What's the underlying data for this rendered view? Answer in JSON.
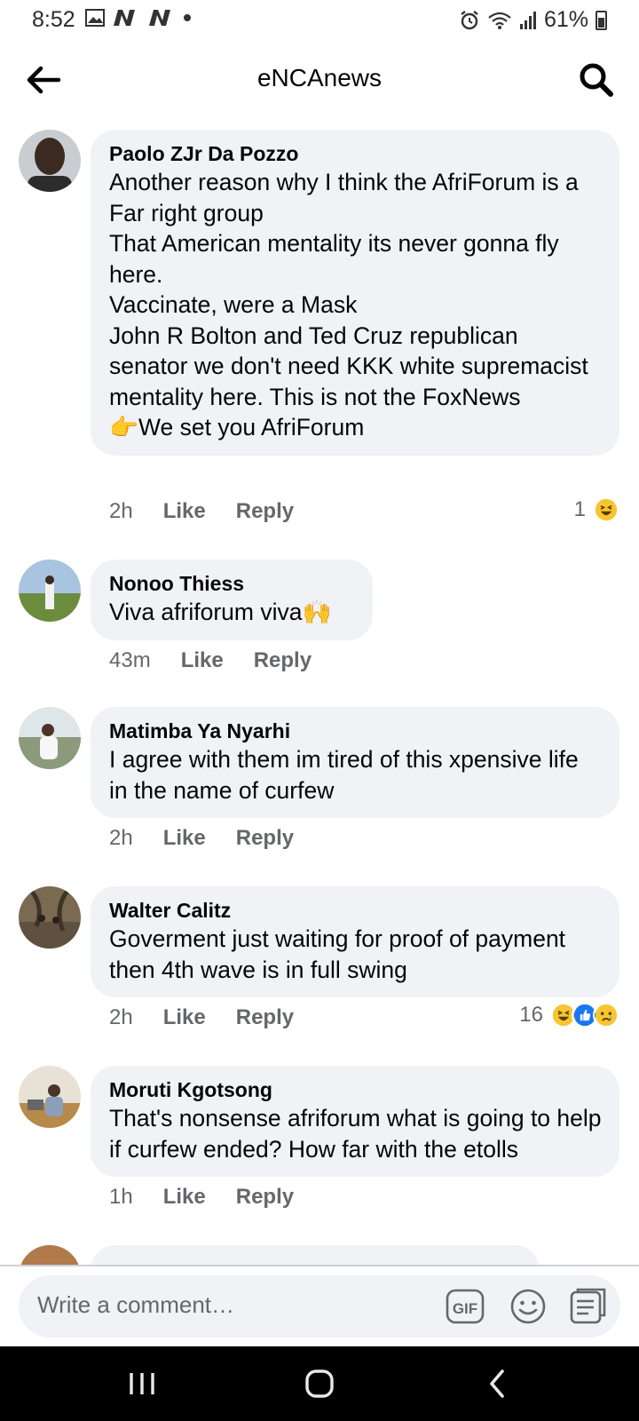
{
  "status_bar": {
    "time": "8:52",
    "battery": "61%"
  },
  "header": {
    "title": "eNCAnews"
  },
  "comments": [
    {
      "author": "Paolo ZJr Da Pozzo",
      "text": "Another reason why I think the AfriForum is a Far right group\nThat American mentality its never gonna fly here.\nVaccinate, were a Mask\nJohn R Bolton and Ted Cruz republican senator we don't need KKK white supremacist mentality here. This is not the FoxNews\n👉We set you AfriForum",
      "time": "2h",
      "like": "Like",
      "reply": "Reply",
      "reaction_count": "1",
      "reactions": [
        "haha"
      ]
    },
    {
      "author": "Nonoo Thiess",
      "text": "Viva afriforum viva🙌",
      "time": "43m",
      "like": "Like",
      "reply": "Reply"
    },
    {
      "author": "Matimba Ya Nyarhi",
      "text": "I agree with them im tired of this xpensive life in the name of curfew",
      "time": "2h",
      "like": "Like",
      "reply": "Reply"
    },
    {
      "author": "Walter Calitz",
      "text": "Goverment just waiting for proof of payment then 4th wave is in full swing",
      "time": "2h",
      "like": "Like",
      "reply": "Reply",
      "reaction_count": "16",
      "reactions": [
        "haha",
        "like",
        "sad"
      ]
    },
    {
      "author": "Moruti Kgotsong",
      "text": "That's nonsense afriforum what is going to help if curfew ended? How far with the etolls",
      "time": "1h",
      "like": "Like",
      "reply": "Reply"
    }
  ],
  "composer": {
    "placeholder": "Write a comment…",
    "gif_label": "GIF"
  },
  "colors": {
    "bubble": "#f0f2f5",
    "meta": "#65676b",
    "like_blue": "#1877f2",
    "haha_yellow": "#f7c531"
  }
}
